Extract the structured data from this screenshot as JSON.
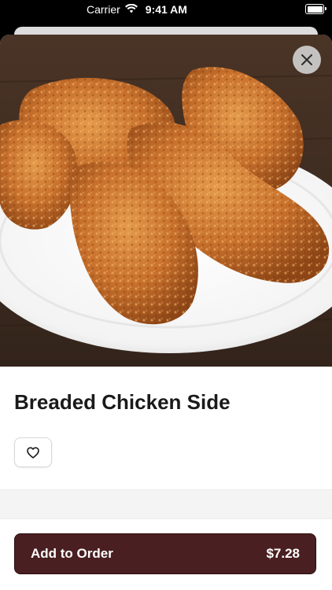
{
  "status_bar": {
    "carrier": "Carrier",
    "time": "9:41 AM",
    "wifi_icon": "wifi-icon",
    "battery_icon": "battery-icon"
  },
  "product": {
    "title": "Breaded Chicken Side",
    "image_description_icon": "fried-chicken-photo"
  },
  "actions": {
    "close_icon": "close-icon",
    "favorite_icon": "heart-icon",
    "add_to_order_label": "Add to Order",
    "price": "$7.28"
  },
  "colors": {
    "button_background": "#4a1f22",
    "button_text": "#ffffff",
    "title_text": "#1a1a1a"
  }
}
